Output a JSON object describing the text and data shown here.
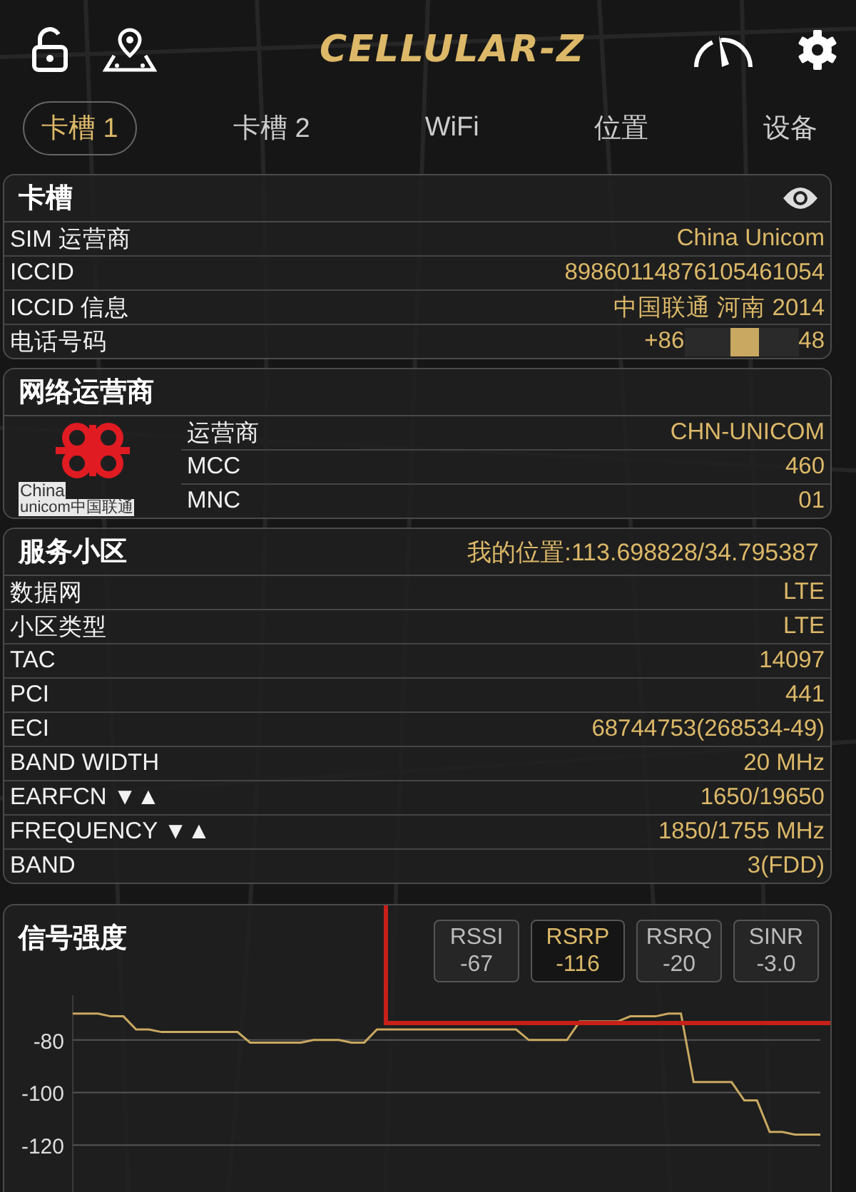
{
  "app_title": "CELLULAR-Z",
  "tabs": [
    {
      "label": "卡槽 1",
      "selected": true
    },
    {
      "label": "卡槽 2",
      "selected": false
    },
    {
      "label": "WiFi",
      "selected": false
    },
    {
      "label": "位置",
      "selected": false
    },
    {
      "label": "设备",
      "selected": false
    }
  ],
  "sim_card": {
    "title": "卡槽",
    "rows": [
      {
        "label": "SIM 运营商",
        "value": "China Unicom"
      },
      {
        "label": "ICCID",
        "value": "89860114876105461054"
      },
      {
        "label": "ICCID 信息",
        "value": "中国联通 河南 2014"
      },
      {
        "label": "电话号码",
        "value": "+86",
        "value_end": "48",
        "redacted": true
      }
    ]
  },
  "network_operator": {
    "title": "网络运营商",
    "logo_text": [
      "China",
      "unicom中国联通"
    ],
    "rows": [
      {
        "label": "运营商",
        "value": "CHN-UNICOM"
      },
      {
        "label": "MCC",
        "value": "460"
      },
      {
        "label": "MNC",
        "value": "01"
      }
    ]
  },
  "serving_cell": {
    "title": "服务小区",
    "location": "我的位置:113.698828/34.795387",
    "rows": [
      {
        "label": "数据网",
        "value": "LTE"
      },
      {
        "label": "小区类型",
        "value": "LTE"
      },
      {
        "label": "TAC",
        "value": "14097"
      },
      {
        "label": "PCI",
        "value": "441"
      },
      {
        "label": "ECI",
        "value": "68744753(268534-49)"
      },
      {
        "label": "BAND WIDTH",
        "value": "20 MHz"
      },
      {
        "label": "EARFCN",
        "arrows": "▼▲",
        "value": "1650/19650"
      },
      {
        "label": "FREQUENCY",
        "arrows": "▼▲",
        "value": "1850/1755 MHz"
      },
      {
        "label": "BAND",
        "value": "3(FDD)"
      }
    ]
  },
  "signal": {
    "title": "信号强度",
    "metrics": [
      {
        "name": "RSSI",
        "value": "-67",
        "selected": false
      },
      {
        "name": "RSRP",
        "value": "-116",
        "selected": true
      },
      {
        "name": "RSRQ",
        "value": "-20",
        "selected": false
      },
      {
        "name": "SINR",
        "value": "-3.0",
        "selected": false
      }
    ],
    "chart_data": {
      "type": "line",
      "grid": true,
      "ylim": [
        -140,
        -63
      ],
      "yticks": [
        -80,
        -100,
        -120
      ],
      "series": [
        {
          "color": "#c9a861",
          "values": [
            -70,
            -70,
            -70,
            -71,
            -71,
            -76,
            -76,
            -77,
            -77,
            -77,
            -77,
            -77,
            -77,
            -77,
            -81,
            -81,
            -81,
            -81,
            -81,
            -80,
            -80,
            -80,
            -81,
            -81,
            -76,
            -76,
            -76,
            -76,
            -76,
            -76,
            -76,
            -76,
            -76,
            -76,
            -76,
            -76,
            -80,
            -80,
            -80,
            -80,
            -73,
            -73,
            -73,
            -73,
            -71,
            -71,
            -71,
            -70,
            -70,
            -96,
            -96,
            -96,
            -96,
            -103,
            -103,
            -115,
            -115,
            -116,
            -116,
            -116
          ]
        }
      ]
    }
  }
}
